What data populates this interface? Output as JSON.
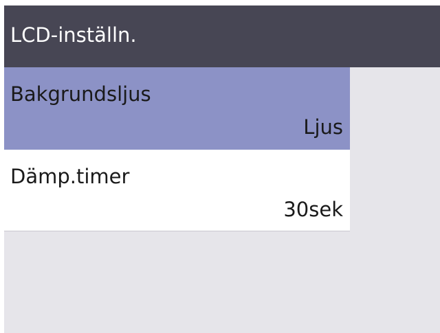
{
  "header": {
    "title": "LCD-inställn."
  },
  "menu": {
    "items": [
      {
        "label": "Bakgrundsljus",
        "value": "Ljus",
        "selected": true
      },
      {
        "label": "Dämp.timer",
        "value": "30sek",
        "selected": false
      }
    ]
  },
  "colors": {
    "header_bg": "#474654",
    "selected_bg": "#8c92c6",
    "panel_bg": "#e6e5ea",
    "item_bg": "#ffffff"
  }
}
